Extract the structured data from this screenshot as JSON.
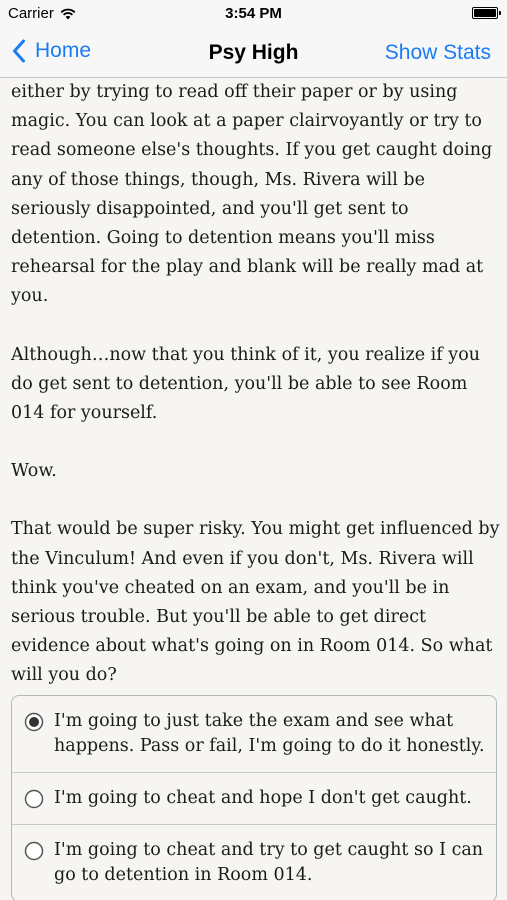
{
  "status_bar": {
    "carrier": "Carrier",
    "time": "3:54 PM",
    "icons": [
      "wifi-icon",
      "battery-icon"
    ]
  },
  "nav": {
    "back_label": "Home",
    "title": "Psy High",
    "right_label": "Show Stats",
    "accent_color": "#1a7cf5"
  },
  "story": {
    "paragraphs": [
      "either by trying to read off their paper or by using magic. You can look at a paper clairvoyantly or try to read someone else's thoughts. If you get caught doing any of those things, though, Ms. Rivera will be seriously disappointed, and you'll get sent to detention. Going to detention means you'll miss rehearsal for the play and blank will be really mad at you.",
      "Although…now that you think of it, you realize if you do get sent to detention, you'll be able to see Room 014 for yourself.",
      "Wow.",
      "That would be super risky. You might get influenced by the Vinculum! And even if you don't, Ms. Rivera will think you've cheated on an exam, and you'll be in serious trouble. But you'll be able to get direct evidence about what's going on in Room 014. So what will you do?"
    ]
  },
  "choices": [
    {
      "label": "I'm going to just take the exam and see what happens. Pass or fail, I'm going to do it honestly.",
      "selected": true
    },
    {
      "label": "I'm going to cheat and hope I don't get caught.",
      "selected": false
    },
    {
      "label": "I'm going to cheat and try to get caught so I can go to detention in Room 014.",
      "selected": false
    }
  ]
}
